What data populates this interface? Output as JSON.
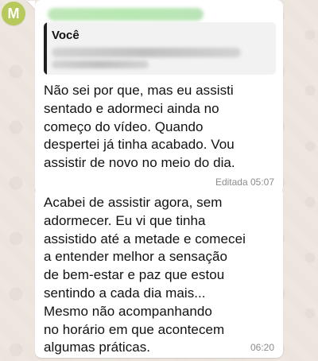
{
  "avatar": {
    "initial": "M"
  },
  "message_1": {
    "reply_author": "Você",
    "text": "Não sei por que, mas eu assisti\nsentado e adormeci ainda no\ncomeço do vídeo. Quando\ndespertei já tinha acabado. Vou\nassistir de novo no meio do dia.",
    "meta": "Editada 05:07"
  },
  "message_2": {
    "text": "Acabei de assistir agora, sem\nadormecer. Eu vi que tinha\nassistido até a metade e comecei\na entender melhor a sensação\nde bem-estar e paz que estou\nsentindo a cada dia mais...\nMesmo não acompanhando\nno horário em que acontecem\nalgumas práticas.",
    "time": "06:20"
  }
}
